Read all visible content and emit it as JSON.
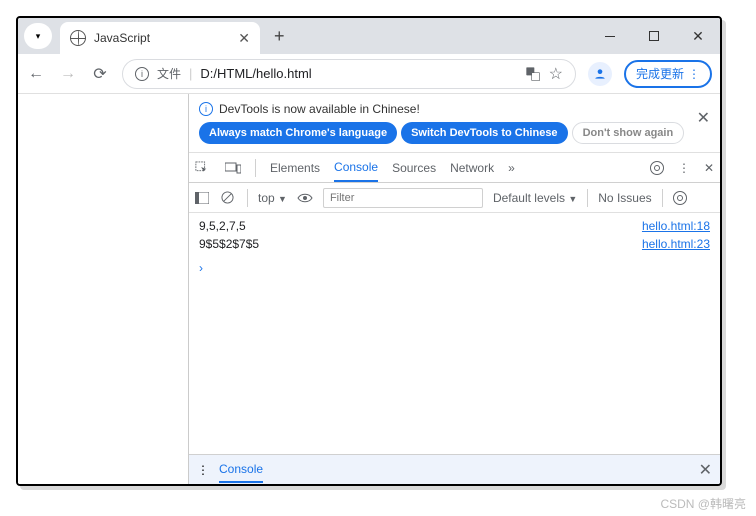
{
  "tab": {
    "title": "JavaScript"
  },
  "address": {
    "label": "文件",
    "url": "D:/HTML/hello.html"
  },
  "update_button": "完成更新",
  "banner": {
    "message": "DevTools is now available in Chinese!",
    "always": "Always match Chrome's language",
    "switch": "Switch DevTools to Chinese",
    "dont": "Don't show again"
  },
  "dt_tabs": {
    "elements": "Elements",
    "console": "Console",
    "sources": "Sources",
    "network": "Network"
  },
  "toolbar": {
    "top": "top",
    "filter_ph": "Filter",
    "levels": "Default levels",
    "noissues": "No Issues"
  },
  "logs": [
    {
      "text": "9,5,2,7,5",
      "link": "hello.html:18"
    },
    {
      "text": "9$5$2$7$5",
      "link": "hello.html:23"
    }
  ],
  "drawer": {
    "label": "Console"
  },
  "watermark": "CSDN @韩曙亮"
}
